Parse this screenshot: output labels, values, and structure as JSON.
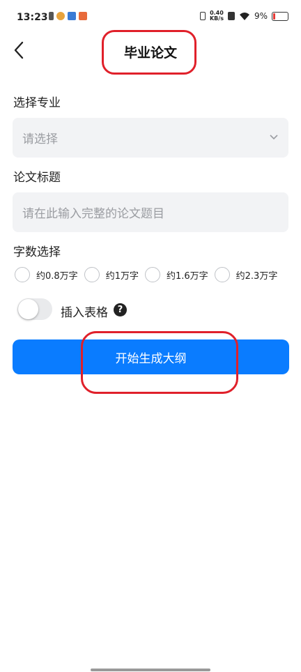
{
  "status_bar": {
    "time": "13:23",
    "net_speed_value": "0.40",
    "net_speed_unit": "KB/s",
    "battery": "9%"
  },
  "header": {
    "title": "毕业论文"
  },
  "form": {
    "major_label": "选择专业",
    "major_placeholder": "请选择",
    "title_label": "论文标题",
    "title_placeholder": "请在此输入完整的论文题目",
    "wordcount_label": "字数选择",
    "wordcount_options": [
      "约0.8万字",
      "约1万字",
      "约1.6万字",
      "约2.3万字"
    ],
    "insert_table_label": "插入表格",
    "insert_table_enabled": false,
    "help_symbol": "?"
  },
  "actions": {
    "generate_label": "开始生成大纲"
  },
  "colors": {
    "primary": "#0a7cff",
    "annotation": "#e0202a"
  }
}
